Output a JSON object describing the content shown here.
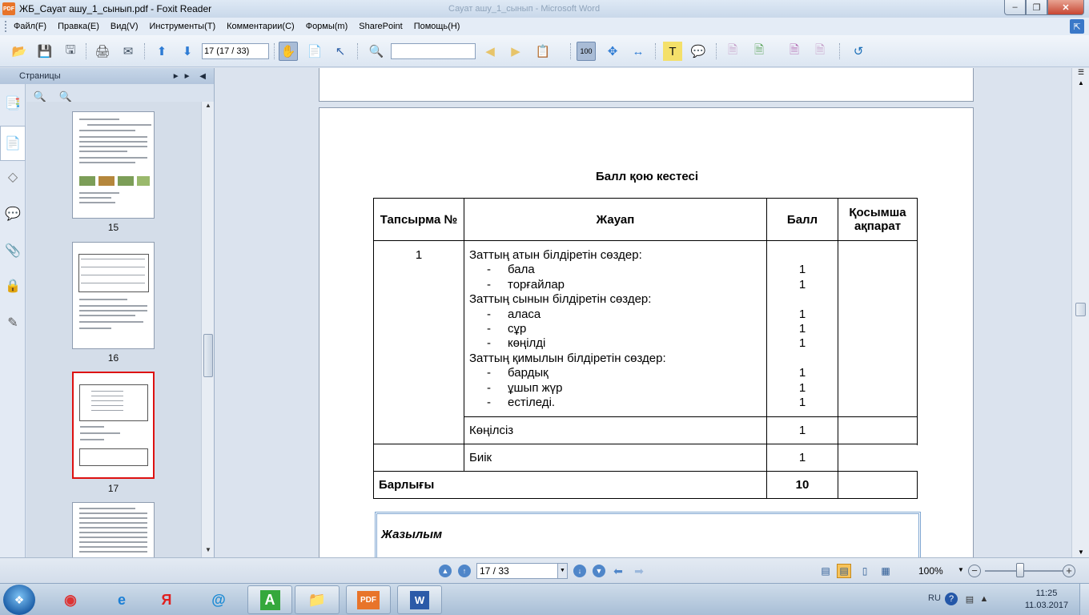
{
  "window": {
    "title": "ЖБ_Сауат ашу_1_сынып.pdf - Foxit Reader",
    "app_icon_text": "PDF",
    "background_window_title": "Сауат ашу_1_сынып - Microsoft Word",
    "controls": [
      "minimize",
      "restore",
      "close"
    ]
  },
  "menu": {
    "items": [
      "Файл(F)",
      "Правка(E)",
      "Вид(V)",
      "Инструменты(T)",
      "Комментарии(C)",
      "Формы(m)",
      "SharePoint",
      "Помощь(H)"
    ]
  },
  "toolbar": {
    "page_field_value": "17 (17 / 33)",
    "find_field_value": ""
  },
  "sidebar": {
    "title": "Страницы",
    "tabs": [
      "pages-icon",
      "bookmarks-icon",
      "layers-icon",
      "comments-icon",
      "attachments-icon",
      "security-icon",
      "signature-icon"
    ],
    "thumbnails": [
      {
        "label": "15",
        "selected": false
      },
      {
        "label": "16",
        "selected": false
      },
      {
        "label": "17",
        "selected": true
      },
      {
        "label": "",
        "selected": false
      }
    ]
  },
  "document": {
    "heading": "Балл қою кестесі",
    "table": {
      "headers": [
        "Тапсырма №",
        "Жауап",
        "Балл",
        "Қосымша ақпарат"
      ],
      "task_number": "1",
      "groups": [
        {
          "title": "Заттың атын білдіретін сөздер:",
          "items": [
            {
              "word": "бала",
              "score": "1"
            },
            {
              "word": "торғайлар",
              "score": "1"
            }
          ]
        },
        {
          "title": "Заттың сынын білдіретін сөздер:",
          "items": [
            {
              "word": "аласа",
              "score": "1"
            },
            {
              "word": "сұр",
              "score": "1"
            },
            {
              "word": "көңілді",
              "score": "1"
            }
          ]
        },
        {
          "title": "Заттың қимылын білдіретін сөздер:",
          "items": [
            {
              "word": "бардық",
              "score": "1"
            },
            {
              "word": "ұшып жүр",
              "score": "1"
            },
            {
              "word": "естіледі.",
              "score": "1"
            }
          ]
        }
      ],
      "extra_rows": [
        {
          "answer": "Көңілсіз",
          "score": "1"
        },
        {
          "answer": "Биік",
          "score": "1"
        }
      ],
      "total": {
        "label": "Барлығы",
        "score": "10"
      }
    },
    "next_section_title": "Жазылым"
  },
  "statusbar": {
    "page_value": "17 / 33",
    "zoom_value": "100%",
    "zoom_fraction": 0.4
  },
  "taskbar": {
    "apps": [
      "chrome-icon",
      "internet-explorer-icon",
      "yandex-icon",
      "mail-icon",
      "a-app-icon",
      "folder-icon",
      "foxit-pdf-icon",
      "word-icon"
    ],
    "yandex_label": "Я",
    "a_app_label": "А",
    "pdf_label": "PDF",
    "word_label": "W",
    "lang": "RU",
    "time": "11:25",
    "date": "11.03.2017"
  }
}
